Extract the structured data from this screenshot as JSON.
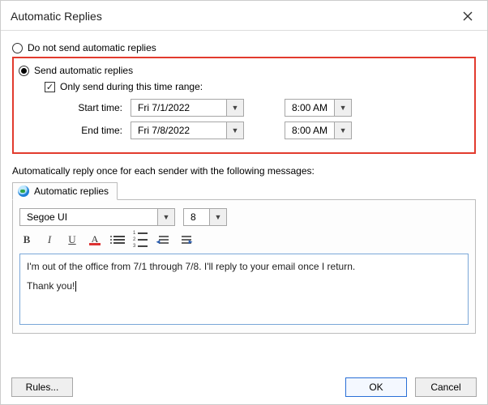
{
  "title": "Automatic Replies",
  "radios": {
    "do_not_send": "Do not send automatic replies",
    "send": "Send automatic replies"
  },
  "checkbox_label": "Only send during this time range:",
  "time": {
    "start_label": "Start time:",
    "end_label": "End time:",
    "start_date": "Fri 7/1/2022",
    "end_date": "Fri 7/8/2022",
    "start_time": "8:00 AM",
    "end_time": "8:00 AM"
  },
  "section_label": "Automatically reply once for each sender with the following messages:",
  "tab_label": "Automatic replies",
  "font": {
    "name": "Segoe UI",
    "size": "8"
  },
  "message": {
    "line1": "I'm out of the office from 7/1 through 7/8. I'll reply to your email once I return.",
    "line2": "Thank you!"
  },
  "buttons": {
    "rules": "Rules...",
    "ok": "OK",
    "cancel": "Cancel"
  }
}
